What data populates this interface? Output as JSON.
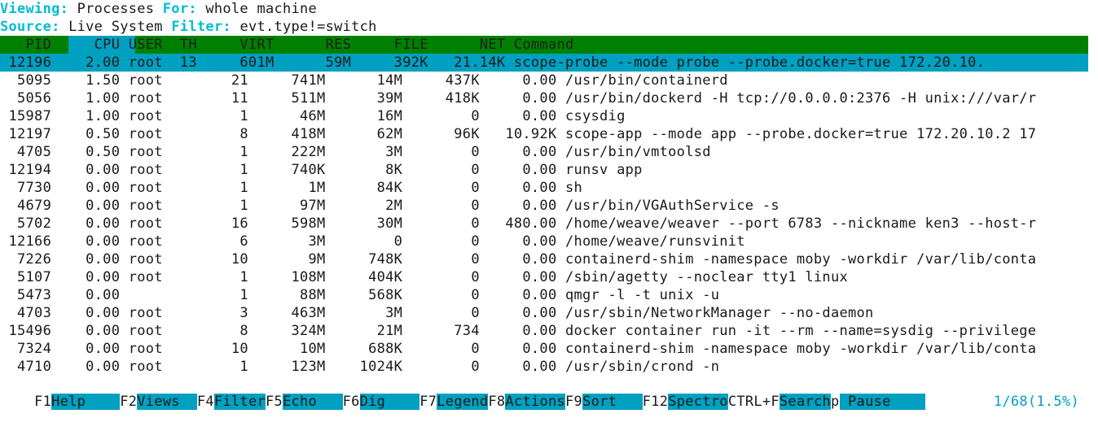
{
  "header": {
    "viewing_label": "Viewing:",
    "viewing_value": "Processes",
    "for_label": "For:",
    "for_value": "whole machine",
    "source_label": "Source:",
    "source_value": "Live System",
    "filter_label": "Filter:",
    "filter_value": "evt.type!=switch"
  },
  "colors": {
    "header_bg": "#008000",
    "selection": "#00a0c0",
    "accent_cyan": "#00bcd4",
    "text": "#1a1a1a"
  },
  "table": {
    "columns": [
      "PID",
      "CPU",
      "USER",
      "TH",
      "VIRT",
      "RES",
      "FILE",
      "NET",
      "Command"
    ],
    "sorted_column": "CPU",
    "header_line": "   PID     CPU USER  TH     VIRT      RES     FILE      NET Command",
    "rows": [
      {
        "selected": true,
        "pid": "12196",
        "cpu": "2.00",
        "user": "root",
        "th": "13",
        "virt": "601M",
        "res": "59M",
        "file": "392K",
        "net": "21.14K",
        "command": "scope-probe --mode probe --probe.docker=true 172.20.10.",
        "line": " 12196    2.00 root  13     601M      59M     392K   21.14K scope-probe --mode probe --probe.docker=true 172.20.10."
      },
      {
        "selected": false,
        "pid": "5095",
        "cpu": "1.50",
        "user": "root",
        "th": "21",
        "virt": "741M",
        "res": "14M",
        "file": "437K",
        "net": "0.00",
        "command": "/usr/bin/containerd",
        "line": "  5095    1.50 root        21     741M      14M     437K     0.00 /usr/bin/containerd"
      },
      {
        "selected": false,
        "pid": "5056",
        "cpu": "1.00",
        "user": "root",
        "th": "11",
        "virt": "511M",
        "res": "39M",
        "file": "418K",
        "net": "0.00",
        "command": "/usr/bin/dockerd -H tcp://0.0.0.0:2376 -H unix:///var/r",
        "line": "  5056    1.00 root        11     511M      39M     418K     0.00 /usr/bin/dockerd -H tcp://0.0.0.0:2376 -H unix:///var/r"
      },
      {
        "selected": false,
        "pid": "15987",
        "cpu": "1.00",
        "user": "root",
        "th": "1",
        "virt": "46M",
        "res": "16M",
        "file": "0",
        "net": "0.00",
        "command": "csysdig",
        "line": " 15987    1.00 root         1      46M      16M        0     0.00 csysdig"
      },
      {
        "selected": false,
        "pid": "12197",
        "cpu": "0.50",
        "user": "root",
        "th": "8",
        "virt": "418M",
        "res": "62M",
        "file": "96K",
        "net": "10.92K",
        "command": "scope-app --mode app --probe.docker=true 172.20.10.2 17",
        "line": " 12197    0.50 root         8     418M      62M      96K   10.92K scope-app --mode app --probe.docker=true 172.20.10.2 17"
      },
      {
        "selected": false,
        "pid": "4705",
        "cpu": "0.50",
        "user": "root",
        "th": "1",
        "virt": "222M",
        "res": "3M",
        "file": "0",
        "net": "0.00",
        "command": "/usr/bin/vmtoolsd",
        "line": "  4705    0.50 root         1     222M       3M        0     0.00 /usr/bin/vmtoolsd"
      },
      {
        "selected": false,
        "pid": "12194",
        "cpu": "0.00",
        "user": "root",
        "th": "1",
        "virt": "740K",
        "res": "8K",
        "file": "0",
        "net": "0.00",
        "command": "runsv app",
        "line": " 12194    0.00 root         1     740K       8K        0     0.00 runsv app"
      },
      {
        "selected": false,
        "pid": "7730",
        "cpu": "0.00",
        "user": "root",
        "th": "1",
        "virt": "1M",
        "res": "84K",
        "file": "0",
        "net": "0.00",
        "command": "sh",
        "line": "  7730    0.00 root         1       1M      84K        0     0.00 sh"
      },
      {
        "selected": false,
        "pid": "4679",
        "cpu": "0.00",
        "user": "root",
        "th": "1",
        "virt": "97M",
        "res": "2M",
        "file": "0",
        "net": "0.00",
        "command": "/usr/bin/VGAuthService -s",
        "line": "  4679    0.00 root         1      97M       2M        0     0.00 /usr/bin/VGAuthService -s"
      },
      {
        "selected": false,
        "pid": "5702",
        "cpu": "0.00",
        "user": "root",
        "th": "16",
        "virt": "598M",
        "res": "30M",
        "file": "0",
        "net": "480.00",
        "command": "/home/weave/weaver --port 6783 --nickname ken3 --host-r",
        "line": "  5702    0.00 root        16     598M      30M        0   480.00 /home/weave/weaver --port 6783 --nickname ken3 --host-r"
      },
      {
        "selected": false,
        "pid": "12166",
        "cpu": "0.00",
        "user": "root",
        "th": "6",
        "virt": "3M",
        "res": "0",
        "file": "0",
        "net": "0.00",
        "command": "/home/weave/runsvinit",
        "line": " 12166    0.00 root         6       3M        0        0     0.00 /home/weave/runsvinit"
      },
      {
        "selected": false,
        "pid": "7226",
        "cpu": "0.00",
        "user": "root",
        "th": "10",
        "virt": "9M",
        "res": "748K",
        "file": "0",
        "net": "0.00",
        "command": "containerd-shim -namespace moby -workdir /var/lib/conta",
        "line": "  7226    0.00 root        10       9M     748K        0     0.00 containerd-shim -namespace moby -workdir /var/lib/conta"
      },
      {
        "selected": false,
        "pid": "5107",
        "cpu": "0.00",
        "user": "root",
        "th": "1",
        "virt": "108M",
        "res": "404K",
        "file": "0",
        "net": "0.00",
        "command": "/sbin/agetty --noclear tty1 linux",
        "line": "  5107    0.00 root         1     108M     404K        0     0.00 /sbin/agetty --noclear tty1 linux"
      },
      {
        "selected": false,
        "pid": "5473",
        "cpu": "0.00",
        "user": "",
        "th": "1",
        "virt": "88M",
        "res": "568K",
        "file": "0",
        "net": "0.00",
        "command": "qmgr -l -t unix -u",
        "line": "  5473    0.00              1      88M     568K        0     0.00 qmgr -l -t unix -u"
      },
      {
        "selected": false,
        "pid": "4703",
        "cpu": "0.00",
        "user": "root",
        "th": "3",
        "virt": "463M",
        "res": "3M",
        "file": "0",
        "net": "0.00",
        "command": "/usr/sbin/NetworkManager --no-daemon",
        "line": "  4703    0.00 root         3     463M       3M        0     0.00 /usr/sbin/NetworkManager --no-daemon"
      },
      {
        "selected": false,
        "pid": "15496",
        "cpu": "0.00",
        "user": "root",
        "th": "8",
        "virt": "324M",
        "res": "21M",
        "file": "734",
        "net": "0.00",
        "command": "docker container run -it --rm --name=sysdig --privilege",
        "line": " 15496    0.00 root         8     324M      21M      734     0.00 docker container run -it --rm --name=sysdig --privilege"
      },
      {
        "selected": false,
        "pid": "7324",
        "cpu": "0.00",
        "user": "root",
        "th": "10",
        "virt": "10M",
        "res": "688K",
        "file": "0",
        "net": "0.00",
        "command": "containerd-shim -namespace moby -workdir /var/lib/conta",
        "line": "  7324    0.00 root        10      10M     688K        0     0.00 containerd-shim -namespace moby -workdir /var/lib/conta"
      },
      {
        "selected": false,
        "pid": "4710",
        "cpu": "0.00",
        "user": "root",
        "th": "1",
        "virt": "123M",
        "res": "1024K",
        "file": "0",
        "net": "0.00",
        "command": "/usr/sbin/crond -n",
        "line": "  4710    0.00 root         1     123M    1024K        0     0.00 /usr/sbin/crond -n"
      }
    ]
  },
  "function_bar": {
    "entries": [
      {
        "key": "F1",
        "label": "Help    "
      },
      {
        "key": "F2",
        "label": "Views  "
      },
      {
        "key": "F4",
        "label": "Filter"
      },
      {
        "key": "F5",
        "label": "Echo   "
      },
      {
        "key": "F6",
        "label": "Dig    "
      },
      {
        "key": "F7",
        "label": "Legend"
      },
      {
        "key": "F8",
        "label": "Actions"
      },
      {
        "key": "F9",
        "label": "Sort   "
      },
      {
        "key": "F12",
        "label": "Spectro"
      },
      {
        "key": "CTRL+F",
        "label": "Search"
      },
      {
        "key": "p",
        "label": " Pause    "
      }
    ],
    "counter": "1/68(1.5%)"
  }
}
